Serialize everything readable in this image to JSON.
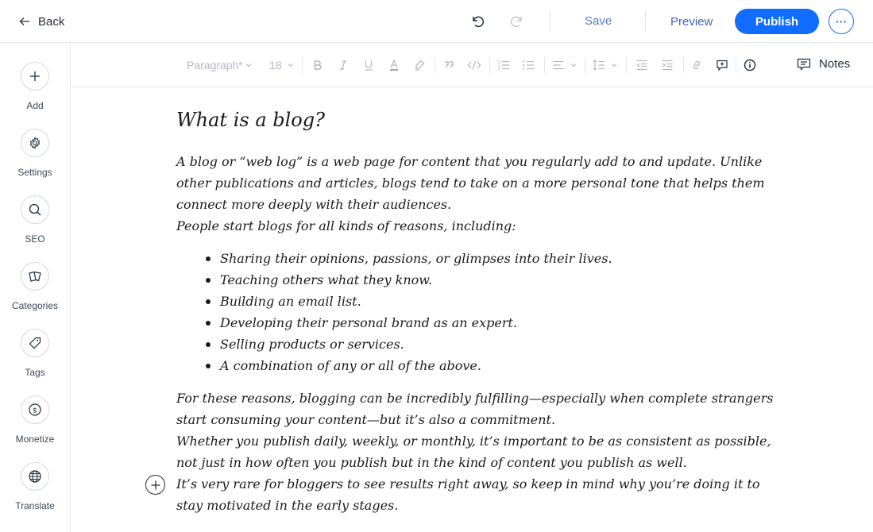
{
  "topbar": {
    "back_label": "Back",
    "save_label": "Save",
    "preview_label": "Preview",
    "publish_label": "Publish",
    "more_label": "···",
    "accent_color": "#116dff"
  },
  "sidebar": {
    "items": [
      {
        "label": "Add",
        "icon": "plus-icon"
      },
      {
        "label": "Settings",
        "icon": "gear-icon"
      },
      {
        "label": "SEO",
        "icon": "search-icon"
      },
      {
        "label": "Categories",
        "icon": "categories-icon"
      },
      {
        "label": "Tags",
        "icon": "tag-icon"
      },
      {
        "label": "Monetize",
        "icon": "dollar-icon"
      },
      {
        "label": "Translate",
        "icon": "globe-icon"
      }
    ]
  },
  "toolbar": {
    "paragraph_style": "Paragraph*",
    "font_size": "18",
    "notes_label": "Notes"
  },
  "post": {
    "title": "What is a blog?",
    "paragraphs_before": [
      "A blog or “web log” is a web page for content that you regularly add to and update. Unlike other publications and articles, blogs tend to take on a more personal tone that helps them connect more deeply with their audiences.",
      "People start blogs for all kinds of reasons, including:"
    ],
    "list": [
      "Sharing their opinions, passions, or glimpses into their lives.",
      "Teaching others what they know.",
      "Building an email list.",
      "Developing their personal brand as an expert.",
      "Selling products or services.",
      "A combination of any or all of the above."
    ],
    "paragraphs_after": [
      "For these reasons, blogging can be incredibly fulfilling—especially when complete strangers start consuming your content—but it’s also a commitment.",
      "Whether you publish daily, weekly, or monthly, it’s important to be as consistent as possible, not just in how often you publish but in the kind of content you publish as well.",
      "It’s very rare for bloggers to see results right away, so keep in mind why you’re doing it to stay motivated in the early stages."
    ]
  }
}
